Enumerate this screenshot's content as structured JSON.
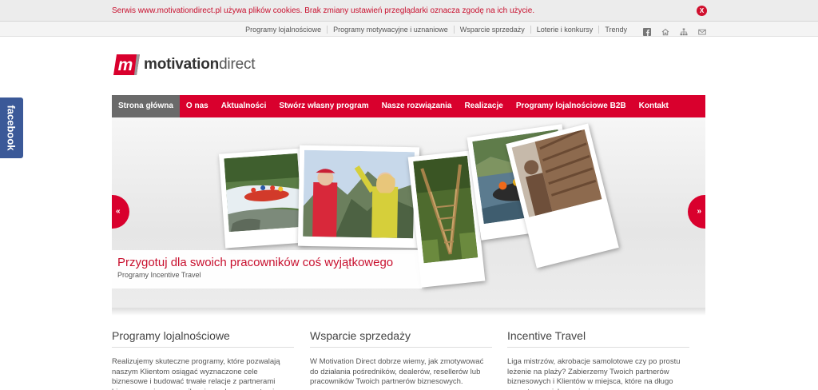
{
  "cookie": {
    "text": "Serwis www.motivationdirect.pl używa plików cookies. Brak zmiany ustawień przeglądarki oznacza zgodę na ich użycie.",
    "close_label": "X"
  },
  "top_nav": {
    "links": [
      "Programy lojalnościowe",
      "Programy motywacyjne i uznaniowe",
      "Wsparcie sprzedaży",
      "Loterie i konkursy",
      "Trendy"
    ],
    "icons": [
      "facebook-icon",
      "home-icon",
      "sitemap-icon",
      "mail-icon"
    ]
  },
  "logo": {
    "mark": "m",
    "bold": "motivation",
    "light": "direct"
  },
  "main_nav": {
    "items": [
      "Strona główna",
      "O nas",
      "Aktualności",
      "Stwórz własny program",
      "Nasze rozwiązania",
      "Realizacje",
      "Programy lojalnościowe B2B",
      "Kontakt"
    ],
    "active_index": 0
  },
  "facebook_tab": {
    "label": "facebook"
  },
  "slider": {
    "prev_label": "«",
    "next_label": "»",
    "caption_title": "Przygotuj dla swoich pracowników coś wyjątkowego",
    "caption_subtitle": "Programy Incentive Travel"
  },
  "columns": [
    {
      "title": "Programy lojalnościowe",
      "text": "Realizujemy skuteczne programy, które pozwalają naszym Klientom osiągać wyznaczone cele biznesowe i budować trwałe relacje z partnerami biznesowymi, pracownikami oraz konsumentami."
    },
    {
      "title": "Wsparcie sprzedaży",
      "text": "W Motivation Direct dobrze wiemy, jak zmotywować do działania pośredników, dealerów, resellerów lub pracowników Twoich partnerów biznesowych."
    },
    {
      "title": "Incentive Travel",
      "text": "Liga mistrzów, akrobacje samolotowe czy po prostu leżenie na plaży? Zabierzemy Twoich partnerów biznesowych i Klientów w miejsca, które na długo pozostaną w ich pamięci."
    }
  ],
  "colors": {
    "brand_red": "#d9002d",
    "active_nav": "#6a6a6a",
    "facebook_blue": "#3b5998"
  }
}
